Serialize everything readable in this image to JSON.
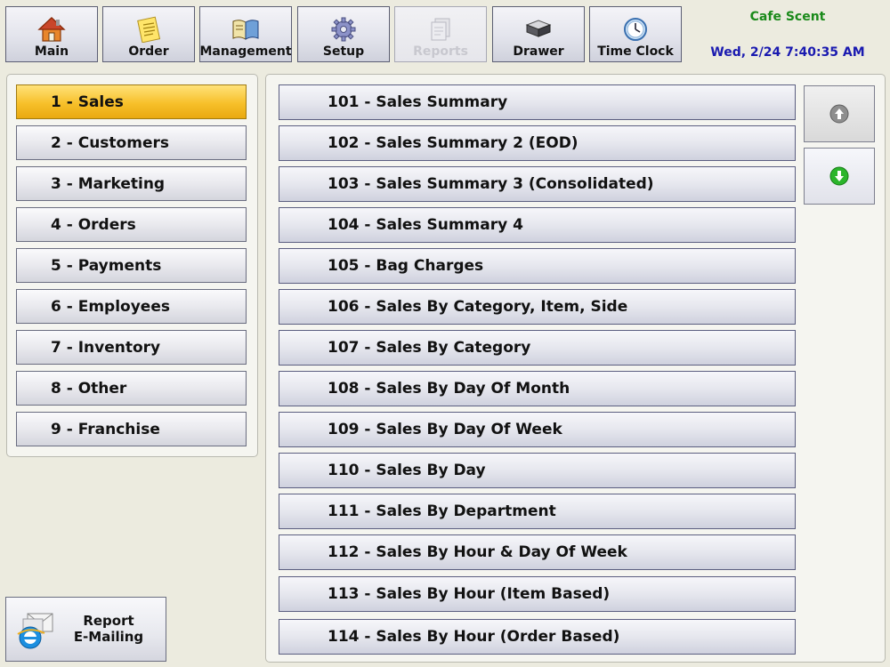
{
  "toolbar": {
    "buttons": [
      {
        "label": "Main",
        "icon": "house-icon"
      },
      {
        "label": "Order",
        "icon": "notepad-icon"
      },
      {
        "label": "Management",
        "icon": "book-icon"
      },
      {
        "label": "Setup",
        "icon": "gear-icon"
      },
      {
        "label": "Reports",
        "icon": "reports-icon",
        "disabled": true
      },
      {
        "label": "Drawer",
        "icon": "cash-drawer-icon"
      },
      {
        "label": "Time Clock",
        "icon": "clock-icon"
      }
    ]
  },
  "header": {
    "store_name": "Cafe Scent",
    "datetime": "Wed, 2/24 7:40:35 AM"
  },
  "categories": [
    {
      "label": "1 - Sales",
      "active": true
    },
    {
      "label": "2 - Customers"
    },
    {
      "label": "3 - Marketing"
    },
    {
      "label": "4 - Orders"
    },
    {
      "label": "5 - Payments"
    },
    {
      "label": "6 - Employees"
    },
    {
      "label": "7 - Inventory"
    },
    {
      "label": "8 - Other"
    },
    {
      "label": "9 - Franchise"
    }
  ],
  "reports": [
    "101 - Sales Summary",
    "102 - Sales Summary 2 (EOD)",
    "103 - Sales Summary 3 (Consolidated)",
    "104 - Sales Summary 4",
    "105 - Bag Charges",
    "106 - Sales By Category, Item, Side",
    "107 - Sales By Category",
    "108 - Sales By Day Of Month",
    "109 - Sales By Day Of Week",
    "110 - Sales By Day",
    "111 - Sales By Department",
    "112 - Sales By Hour & Day Of Week",
    "113 - Sales By Hour (Item Based)",
    "114 - Sales By Hour (Order Based)"
  ],
  "email_button": {
    "line1": "Report",
    "line2": "E-Mailing",
    "icon": "email-report-icon"
  },
  "colors": {
    "active": "#f7c02a",
    "store_name": "#1a8a1a",
    "datetime": "#1a1ab0",
    "scroll_down": "#2bb52b"
  }
}
